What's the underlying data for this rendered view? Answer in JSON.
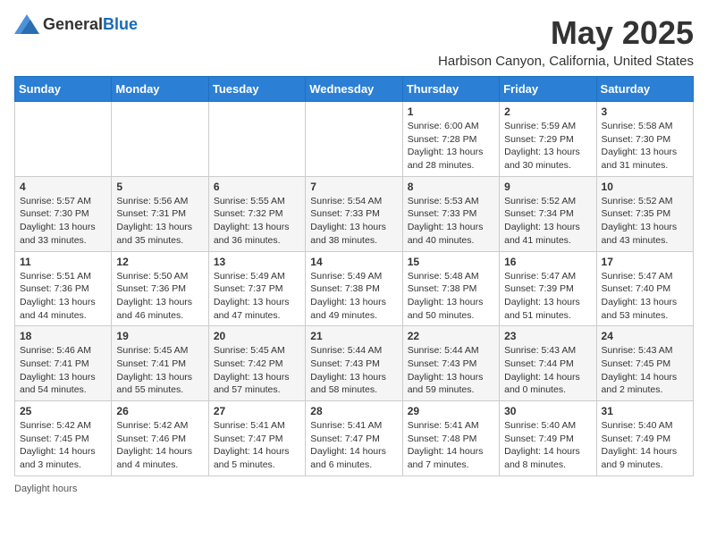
{
  "header": {
    "logo_general": "General",
    "logo_blue": "Blue",
    "month_title": "May 2025",
    "location": "Harbison Canyon, California, United States"
  },
  "footer": {
    "daylight_label": "Daylight hours"
  },
  "days_of_week": [
    "Sunday",
    "Monday",
    "Tuesday",
    "Wednesday",
    "Thursday",
    "Friday",
    "Saturday"
  ],
  "weeks": [
    [
      {
        "day": "",
        "sunrise": "",
        "sunset": "",
        "daylight": ""
      },
      {
        "day": "",
        "sunrise": "",
        "sunset": "",
        "daylight": ""
      },
      {
        "day": "",
        "sunrise": "",
        "sunset": "",
        "daylight": ""
      },
      {
        "day": "",
        "sunrise": "",
        "sunset": "",
        "daylight": ""
      },
      {
        "day": "1",
        "sunrise": "Sunrise: 6:00 AM",
        "sunset": "Sunset: 7:28 PM",
        "daylight": "Daylight: 13 hours and 28 minutes."
      },
      {
        "day": "2",
        "sunrise": "Sunrise: 5:59 AM",
        "sunset": "Sunset: 7:29 PM",
        "daylight": "Daylight: 13 hours and 30 minutes."
      },
      {
        "day": "3",
        "sunrise": "Sunrise: 5:58 AM",
        "sunset": "Sunset: 7:30 PM",
        "daylight": "Daylight: 13 hours and 31 minutes."
      }
    ],
    [
      {
        "day": "4",
        "sunrise": "Sunrise: 5:57 AM",
        "sunset": "Sunset: 7:30 PM",
        "daylight": "Daylight: 13 hours and 33 minutes."
      },
      {
        "day": "5",
        "sunrise": "Sunrise: 5:56 AM",
        "sunset": "Sunset: 7:31 PM",
        "daylight": "Daylight: 13 hours and 35 minutes."
      },
      {
        "day": "6",
        "sunrise": "Sunrise: 5:55 AM",
        "sunset": "Sunset: 7:32 PM",
        "daylight": "Daylight: 13 hours and 36 minutes."
      },
      {
        "day": "7",
        "sunrise": "Sunrise: 5:54 AM",
        "sunset": "Sunset: 7:33 PM",
        "daylight": "Daylight: 13 hours and 38 minutes."
      },
      {
        "day": "8",
        "sunrise": "Sunrise: 5:53 AM",
        "sunset": "Sunset: 7:33 PM",
        "daylight": "Daylight: 13 hours and 40 minutes."
      },
      {
        "day": "9",
        "sunrise": "Sunrise: 5:52 AM",
        "sunset": "Sunset: 7:34 PM",
        "daylight": "Daylight: 13 hours and 41 minutes."
      },
      {
        "day": "10",
        "sunrise": "Sunrise: 5:52 AM",
        "sunset": "Sunset: 7:35 PM",
        "daylight": "Daylight: 13 hours and 43 minutes."
      }
    ],
    [
      {
        "day": "11",
        "sunrise": "Sunrise: 5:51 AM",
        "sunset": "Sunset: 7:36 PM",
        "daylight": "Daylight: 13 hours and 44 minutes."
      },
      {
        "day": "12",
        "sunrise": "Sunrise: 5:50 AM",
        "sunset": "Sunset: 7:36 PM",
        "daylight": "Daylight: 13 hours and 46 minutes."
      },
      {
        "day": "13",
        "sunrise": "Sunrise: 5:49 AM",
        "sunset": "Sunset: 7:37 PM",
        "daylight": "Daylight: 13 hours and 47 minutes."
      },
      {
        "day": "14",
        "sunrise": "Sunrise: 5:49 AM",
        "sunset": "Sunset: 7:38 PM",
        "daylight": "Daylight: 13 hours and 49 minutes."
      },
      {
        "day": "15",
        "sunrise": "Sunrise: 5:48 AM",
        "sunset": "Sunset: 7:38 PM",
        "daylight": "Daylight: 13 hours and 50 minutes."
      },
      {
        "day": "16",
        "sunrise": "Sunrise: 5:47 AM",
        "sunset": "Sunset: 7:39 PM",
        "daylight": "Daylight: 13 hours and 51 minutes."
      },
      {
        "day": "17",
        "sunrise": "Sunrise: 5:47 AM",
        "sunset": "Sunset: 7:40 PM",
        "daylight": "Daylight: 13 hours and 53 minutes."
      }
    ],
    [
      {
        "day": "18",
        "sunrise": "Sunrise: 5:46 AM",
        "sunset": "Sunset: 7:41 PM",
        "daylight": "Daylight: 13 hours and 54 minutes."
      },
      {
        "day": "19",
        "sunrise": "Sunrise: 5:45 AM",
        "sunset": "Sunset: 7:41 PM",
        "daylight": "Daylight: 13 hours and 55 minutes."
      },
      {
        "day": "20",
        "sunrise": "Sunrise: 5:45 AM",
        "sunset": "Sunset: 7:42 PM",
        "daylight": "Daylight: 13 hours and 57 minutes."
      },
      {
        "day": "21",
        "sunrise": "Sunrise: 5:44 AM",
        "sunset": "Sunset: 7:43 PM",
        "daylight": "Daylight: 13 hours and 58 minutes."
      },
      {
        "day": "22",
        "sunrise": "Sunrise: 5:44 AM",
        "sunset": "Sunset: 7:43 PM",
        "daylight": "Daylight: 13 hours and 59 minutes."
      },
      {
        "day": "23",
        "sunrise": "Sunrise: 5:43 AM",
        "sunset": "Sunset: 7:44 PM",
        "daylight": "Daylight: 14 hours and 0 minutes."
      },
      {
        "day": "24",
        "sunrise": "Sunrise: 5:43 AM",
        "sunset": "Sunset: 7:45 PM",
        "daylight": "Daylight: 14 hours and 2 minutes."
      }
    ],
    [
      {
        "day": "25",
        "sunrise": "Sunrise: 5:42 AM",
        "sunset": "Sunset: 7:45 PM",
        "daylight": "Daylight: 14 hours and 3 minutes."
      },
      {
        "day": "26",
        "sunrise": "Sunrise: 5:42 AM",
        "sunset": "Sunset: 7:46 PM",
        "daylight": "Daylight: 14 hours and 4 minutes."
      },
      {
        "day": "27",
        "sunrise": "Sunrise: 5:41 AM",
        "sunset": "Sunset: 7:47 PM",
        "daylight": "Daylight: 14 hours and 5 minutes."
      },
      {
        "day": "28",
        "sunrise": "Sunrise: 5:41 AM",
        "sunset": "Sunset: 7:47 PM",
        "daylight": "Daylight: 14 hours and 6 minutes."
      },
      {
        "day": "29",
        "sunrise": "Sunrise: 5:41 AM",
        "sunset": "Sunset: 7:48 PM",
        "daylight": "Daylight: 14 hours and 7 minutes."
      },
      {
        "day": "30",
        "sunrise": "Sunrise: 5:40 AM",
        "sunset": "Sunset: 7:49 PM",
        "daylight": "Daylight: 14 hours and 8 minutes."
      },
      {
        "day": "31",
        "sunrise": "Sunrise: 5:40 AM",
        "sunset": "Sunset: 7:49 PM",
        "daylight": "Daylight: 14 hours and 9 minutes."
      }
    ]
  ]
}
